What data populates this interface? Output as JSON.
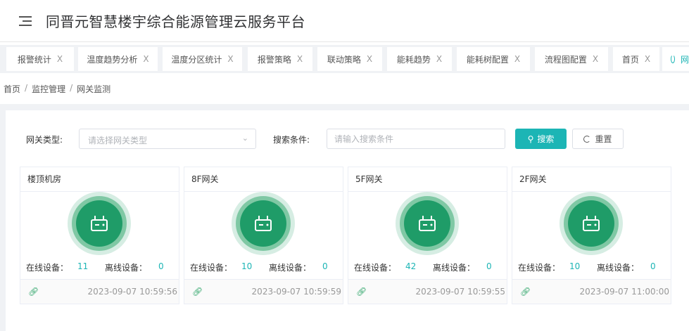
{
  "header": {
    "title": "同晋元智慧楼宇综合能源管理云服务平台",
    "menu_icon": "hamburger-icon"
  },
  "tabs": [
    {
      "label": "报警统计"
    },
    {
      "label": "温度趋势分析"
    },
    {
      "label": "温度分区统计"
    },
    {
      "label": "报警策略"
    },
    {
      "label": "联动策略"
    },
    {
      "label": "能耗趋势"
    },
    {
      "label": "能耗树配置"
    },
    {
      "label": "流程图配置"
    },
    {
      "label": "首页"
    },
    {
      "label": "网",
      "active": true
    }
  ],
  "tab_close": "X",
  "breadcrumb": [
    "首页",
    "监控管理",
    "网关监测"
  ],
  "breadcrumb_sep": "/",
  "filters": {
    "type_label": "网关类型:",
    "type_placeholder": "请选择网关类型",
    "cond_label": "搜索条件:",
    "cond_placeholder": "请输入搜索条件",
    "search_label": "搜索",
    "reset_label": "重置"
  },
  "stat_labels": {
    "online": "在线设备：",
    "offline": "离线设备："
  },
  "cards": [
    {
      "title": "楼顶机房",
      "online": "11",
      "offline": "0",
      "time": "2023-09-07 10:59:56"
    },
    {
      "title": "8F网关",
      "online": "10",
      "offline": "0",
      "time": "2023-09-07 10:59:59"
    },
    {
      "title": "5F网关",
      "online": "42",
      "offline": "0",
      "time": "2023-09-07 10:59:55"
    },
    {
      "title": "2F网关",
      "online": "10",
      "offline": "0",
      "time": "2023-09-07 11:00:00"
    }
  ],
  "colors": {
    "accent": "#1cb5b5",
    "gateway_green": "#1f9c68"
  }
}
